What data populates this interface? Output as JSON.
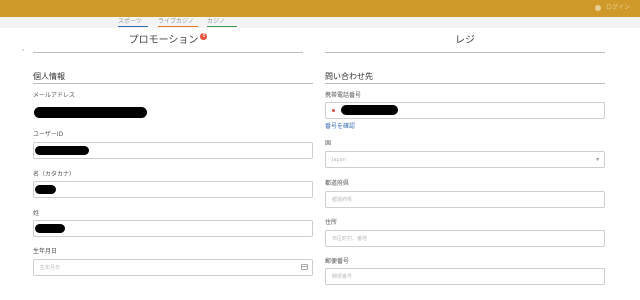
{
  "topbar": {
    "user_text": "ログイン"
  },
  "subnav": {
    "tabs": [
      "スポーツ",
      "ライブカジノ",
      "カジノ"
    ]
  },
  "main_tabs": {
    "promotion": "プロモーション",
    "promotion_badge": "8",
    "register": "レジ"
  },
  "personal": {
    "title": "個人情報",
    "email_label": "メールアドレス",
    "userid_label": "ユーザーID",
    "firstname_label": "名（カタカナ）",
    "lastname_label": "姓",
    "birthdate_label": "生年月日",
    "birthdate_placeholder": "生年月日"
  },
  "contact": {
    "title": "問い合わせ先",
    "phone_label": "携帯電話番号",
    "verify_link": "番号を確認",
    "country_label": "国",
    "country_value": "Japan",
    "prefecture_label": "都道府県",
    "prefecture_placeholder": "都道府県",
    "address_label": "住所",
    "address_placeholder": "市区町村、番地",
    "postal_label": "郵便番号",
    "postal_placeholder": "郵便番号"
  },
  "colors": {
    "topbar": "#cf9a2a",
    "badge": "#e74c3c",
    "link": "#3a6fb5"
  }
}
